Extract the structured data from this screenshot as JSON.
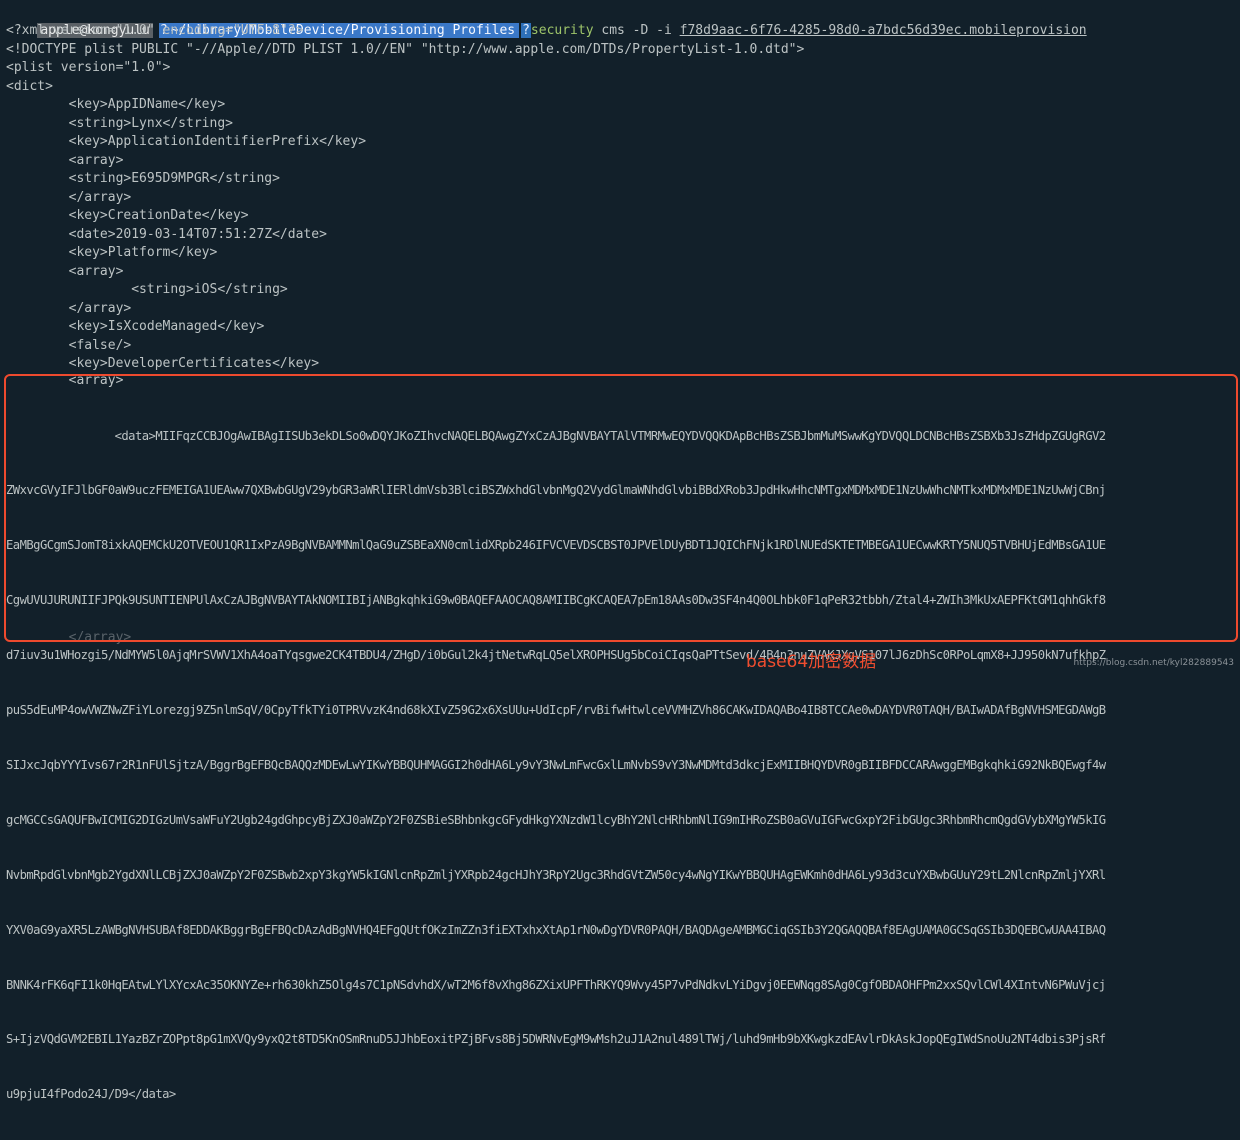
{
  "prompt": {
    "user": "apple@kongyulu",
    "q_icon": "?",
    "path": "~/Library/MobileDevice/Provisioning Profiles",
    "q_icon2": "?",
    "command": "security",
    "args": " cms -D -i ",
    "filename": "f78d9aac-6f76-4285-98d0-a7bdc56d39ec.mobileprovision"
  },
  "lines": [
    "<?xml version=\"1.0\" encoding=\"UTF-8\"?>",
    "<!DOCTYPE plist PUBLIC \"-//Apple//DTD PLIST 1.0//EN\" \"http://www.apple.com/DTDs/PropertyList-1.0.dtd\">",
    "<plist version=\"1.0\">",
    "<dict>",
    "        <key>AppIDName</key>",
    "        <string>Lynx</string>",
    "        <key>ApplicationIdentifierPrefix</key>",
    "        <array>",
    "        <string>E695D9MPGR</string>",
    "        </array>",
    "        <key>CreationDate</key>",
    "        <date>2019-03-14T07:51:27Z</date>",
    "        <key>Platform</key>",
    "        <array>",
    "                <string>iOS</string>",
    "        </array>",
    "        <key>IsXcodeManaged</key>",
    "        <false/>",
    "        <key>DeveloperCertificates</key>",
    "        <array>"
  ],
  "base64_lines": [
    "                <data>MIIFqzCCBJOgAwIBAgIISUb3ekDLSo0wDQYJKoZIhvcNAQELBQAwgZYxCzAJBgNVBAYTAlVTMRMwEQYDVQQKDApBcHBsZSBJbmMuMSwwKgYDVQQLDCNBcHBsZSBXb3JsZHdpZGUgRGV2",
    "ZWxvcGVyIFJlbGF0aW9uczFEMEIGA1UEAww7QXBwbGUgV29ybGR3aWRlIERldmVsb3BlciBSZWxhdGlvbnMgQ2VydGlmaWNhdGlvbiBBdXRob3JpdHkwHhcNMTgxMDMxMDE1NzUwWhcNMTkxMDMxMDE1NzUwWjCBnj",
    "EaMBgGCgmSJomT8ixkAQEMCkU2OTVEOU1QR1IxPzA9BgNVBAMMNmlQaG9uZSBEaXN0cmlidXRpb246IFVCVEVDSCBST0JPVElDUyBDT1JQIChFNjk1RDlNUEdSKTETMBEGA1UECwwKRTY5NUQ5TVBHUjEdMBsGA1UE",
    "CgwUVUJURUNIIFJPQk9USUNTIENPUlAxCzAJBgNVBAYTAkNOMIIBIjANBgkqhkiG9w0BAQEFAAOCAQ8AMIIBCgKCAQEA7pEm18AAs0Dw3SF4n4Q0OLhbk0F1qPeR32tbbh/Ztal4+ZWIh3MkUxAEPFKtGM1qhhGkf8",
    "d7iuv3u1WHozgi5/NdMYW5l0AjqMrSVWV1XhA4oaTYqsgwe2CK4TBDU4/ZHgD/i0bGul2k4jtNetwRqLQ5elXROPHSUg5bCoiCIqsQaPTtSevd/4B4n3nuZVAKJXgVS107lJ6zDhSc0RPoLqmX8+JJ950kN7ufkhpZ",
    "puS5dEuMP4owVWZNwZFiYLorezgj9Z5nlmSqV/0CpyTfkTYi0TPRVvzK4nd68kXIvZ59G2x6XsUUu+UdIcpF/rvBifwHtwlceVVMHZVh86CAKwIDAQABo4IB8TCCAe0wDAYDVR0TAQH/BAIwADAfBgNVHSMEGDAWgB",
    "SIJxcJqbYYYIvs67r2R1nFUlSjtzA/BggrBgEFBQcBAQQzMDEwLwYIKwYBBQUHMAGGI2h0dHA6Ly9vY3NwLmFwcGxlLmNvbS9vY3NwMDMtd3dkcjExMIIBHQYDVR0gBIIBFDCCARAwggEMBgkqhkiG92NkBQEwgf4w",
    "gcMGCCsGAQUFBwICMIG2DIGzUmVsaWFuY2Ugb24gdGhpcyBjZXJ0aWZpY2F0ZSBieSBhbnkgcGFydHkgYXNzdW1lcyBhY2NlcHRhbmNlIG9mIHRoZSB0aGVuIGFwcGxpY2FibGUgc3RhbmRhcmQgdGVybXMgYW5kIG",
    "NvbmRpdGlvbnMgb2YgdXNlLCBjZXJ0aWZpY2F0ZSBwb2xpY3kgYW5kIGNlcnRpZmljYXRpb24gcHJhY3RpY2Ugc3RhdGVtZW50cy4wNgYIKwYBBQUHAgEWKmh0dHA6Ly93d3cuYXBwbGUuY29tL2NlcnRpZmljYXRl",
    "YXV0aG9yaXR5LzAWBgNVHSUBAf8EDDAKBggrBgEFBQcDAzAdBgNVHQ4EFgQUtfOKzImZZn3fiEXTxhxXtAp1rN0wDgYDVR0PAQH/BAQDAgeAMBMGCiqGSIb3Y2QGAQQBAf8EAgUAMA0GCSqGSIb3DQEBCwUAA4IBAQ",
    "BNNK4rFK6qFI1k0HqEAtwLYlXYcxAc35OKNYZe+rh630khZ5Olg4s7C1pNSdvhdX/wT2M6f8vXhg86ZXixUPFThRKYQ9Wvy45P7vPdNdkvLYiDgvj0EEWNqg8SAg0CgfOBDAOHFPm2xxSQvlCWl4XIntvN6PWuVjcj",
    "S+IjzVQdGVM2EBIL1YazBZrZOPpt8pG1mXVQy9yxQ2t8TD5KnOSmRnuD5JJhbEoxitPZjBFvs8Bj5DWRNvEgM9wMsh2uJ1A2nul489lTWj/luhd9mHb9bXKwgkzdEAvlrDkAskJopQEgIWdSnoUu2NT4dbis3PjsRf",
    "u9pjuI4fPodo24J/D9</data>"
  ],
  "trailing_line": "        </array>",
  "caption": "base64加密数据",
  "watermark": "https://blog.csdn.net/kyl282889543",
  "colors": {
    "background": "#12202a",
    "highlight": "#ee4a2e",
    "prompt_path_bg": "#3a78c8",
    "command": "#9ec56a"
  }
}
